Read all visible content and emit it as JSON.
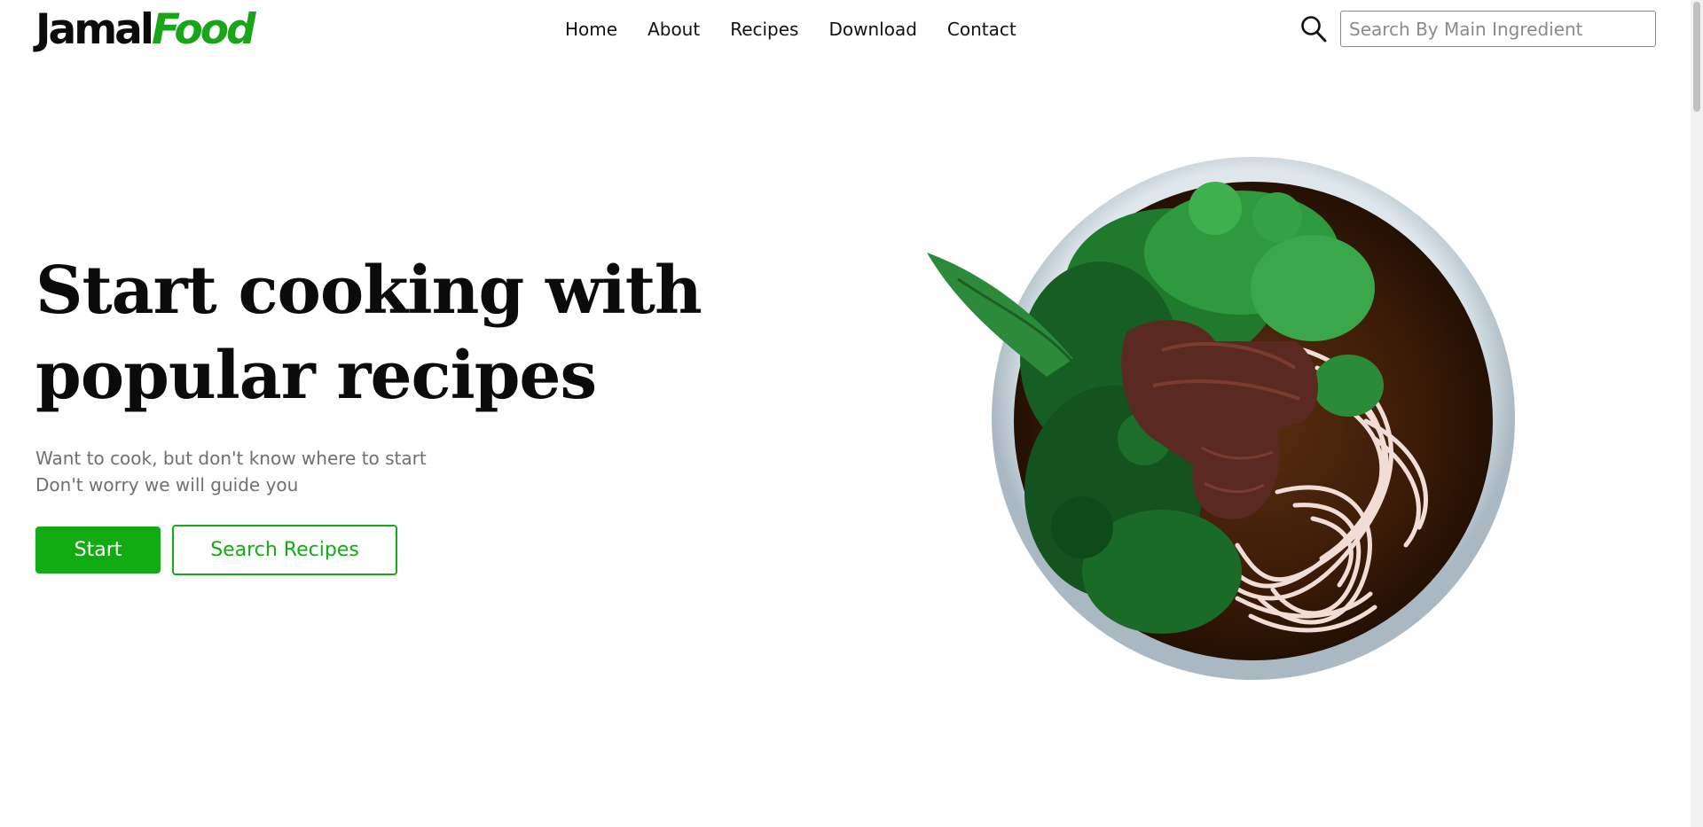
{
  "brand": {
    "name_part1": "Jamal",
    "name_part2": "Food",
    "accent_color": "#18a518"
  },
  "nav": {
    "items": [
      {
        "label": "Home"
      },
      {
        "label": "About"
      },
      {
        "label": "Recipes"
      },
      {
        "label": "Download"
      },
      {
        "label": "Contact"
      }
    ]
  },
  "search": {
    "placeholder": "Search By Main Ingredient",
    "value": "",
    "icon": "search-icon"
  },
  "hero": {
    "title_line1": "Start cooking with",
    "title_line2": "popular recipes",
    "subtitle_line1": "Want to cook, but don't know where to start",
    "subtitle_line2": "Don't worry we will guide you",
    "start_label": "Start",
    "search_recipes_label": "Search Recipes",
    "button_color": "#13ab13"
  },
  "image": {
    "subject": "noodle-soup-bowl"
  }
}
